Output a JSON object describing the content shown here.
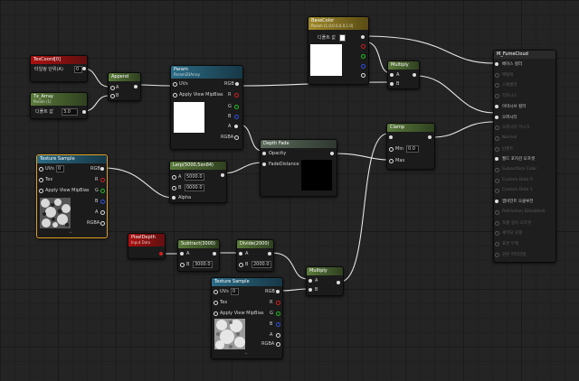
{
  "nodes": {
    "texcoord": {
      "title": "TexCoord[0]",
      "pin_label": "타일링 단위(A)",
      "pin_value": "0",
      "value_label": "0"
    },
    "tex_array": {
      "title": "Tx_Array",
      "subtitle": "Param (1)",
      "field_label": "디폴트 값",
      "field_value": "3.0"
    },
    "append": {
      "title": "Append",
      "pin_a": "A",
      "pin_b": "B"
    },
    "param": {
      "title": "Param",
      "subtitle": "Param2DArray",
      "pin_uvs": "UVs",
      "pin_apply": "Apply View MipBias",
      "out_rgb": "RGB",
      "out_r": "R",
      "out_g": "G",
      "out_b": "B",
      "out_a": "A",
      "out_rgba": "RGBA"
    },
    "basecolor": {
      "title": "BaseColor",
      "subtitle": "Param (1.0,0.0,0.0,1.0)",
      "field_label": "디폴트 값"
    },
    "multiply_top": {
      "title": "Multiply",
      "pin_a": "A",
      "pin_b": "B"
    },
    "depth_fade": {
      "title": "Depth Fade",
      "pin_opacity": "Opacity",
      "pin_fade": "FadeDistance"
    },
    "lerp": {
      "title": "Lerp(5000,5en84)",
      "pin_a": "A",
      "val_a": "5000.0",
      "pin_b": "B",
      "val_b": "0000.0",
      "pin_alpha": "Alpha"
    },
    "tex_sample_left": {
      "title": "Texture Sample",
      "pin_uvs": "UVs",
      "uvs_val": "0",
      "pin_tex": "Tex",
      "pin_apply": "Apply View MipBias",
      "out_rgb": "RGB",
      "out_r": "R",
      "out_g": "G",
      "out_b": "B",
      "out_a": "A",
      "out_rgba": "RGBA"
    },
    "clamp": {
      "title": "Clamp",
      "pin_min": "Min",
      "min_val": "0.0",
      "pin_max": "Max"
    },
    "pixeldepth": {
      "title": "PixelDepth",
      "subtitle": "Input Data"
    },
    "subtract": {
      "title": "Subtract(3000)",
      "pin_a": "A",
      "pin_b": "B",
      "val_b": "3000.0"
    },
    "divide": {
      "title": "Divide(2000)",
      "pin_a": "A",
      "pin_b": "B",
      "val_b": "2000.0"
    },
    "multiply_bottom": {
      "title": "Multiply",
      "pin_a": "A",
      "pin_b": "B"
    },
    "tex_sample_bottom": {
      "title": "Texture Sample",
      "pin_uvs": "UVs",
      "uvs_val": "0",
      "pin_tex": "Tex",
      "pin_apply": "Apply View MipBias",
      "out_rgb": "RGB",
      "out_r": "R",
      "out_g": "G",
      "out_b": "B",
      "out_a": "A",
      "out_rgba": "RGBA"
    },
    "material_out": {
      "title": "M_FumeCloud",
      "pins": [
        {
          "label": "베이스 컬러",
          "active": true
        },
        {
          "label": "메탈릭",
          "active": false
        },
        {
          "label": "스페큘러",
          "active": false
        },
        {
          "label": "러프니스",
          "active": false
        },
        {
          "label": "이미시브 컬러",
          "active": true
        },
        {
          "label": "오파시티",
          "active": true
        },
        {
          "label": "오파시티 마스크",
          "active": false
        },
        {
          "label": "Normal",
          "active": false
        },
        {
          "label": "탄젠트",
          "active": false
        },
        {
          "label": "월드 포지션 오프셋",
          "active": true
        },
        {
          "label": "Subsurface Color",
          "active": false
        },
        {
          "label": "Custom Data 0",
          "active": false
        },
        {
          "label": "Custom Data 1",
          "active": false
        },
        {
          "label": "앰비언트 오클루전",
          "active": true
        },
        {
          "label": "Refraction (Disabled)",
          "active": false
        },
        {
          "label": "픽셀 깊이 오프셋",
          "active": false
        },
        {
          "label": "셰이딩 모델",
          "active": false
        },
        {
          "label": "표면 두께",
          "active": false
        },
        {
          "label": "원본 머티리얼",
          "active": false
        }
      ]
    }
  },
  "colors": {
    "wire": "#e8e8e8",
    "red_pin": "#d02020",
    "green_pin": "#20c020",
    "blue_pin": "#3050e0",
    "selection": "#e0a020"
  }
}
